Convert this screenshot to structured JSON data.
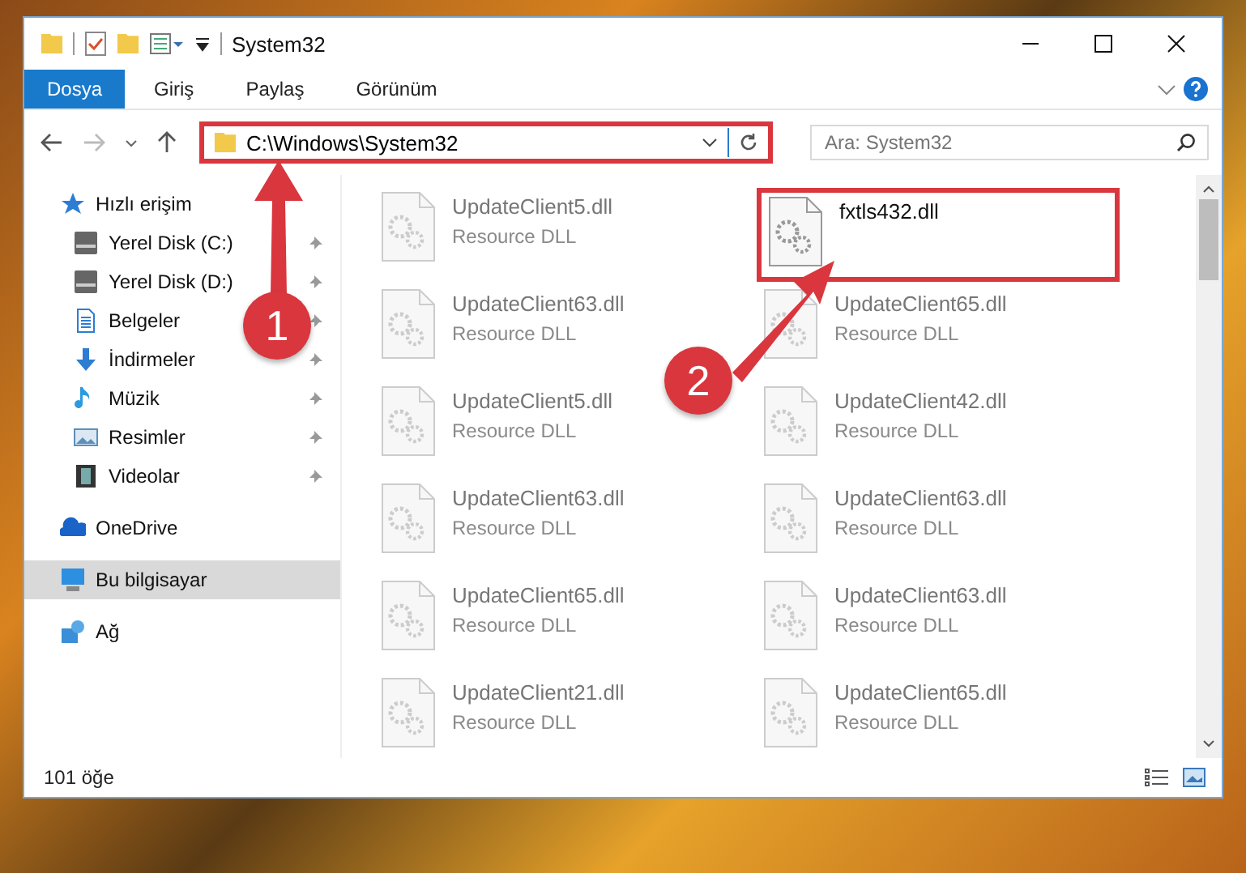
{
  "window": {
    "title": "System32"
  },
  "ribbon_tabs": [
    {
      "label": "Dosya",
      "selected": true
    },
    {
      "label": "Giriş",
      "selected": false
    },
    {
      "label": "Paylaş",
      "selected": false
    },
    {
      "label": "Görünüm",
      "selected": false
    }
  ],
  "address": {
    "value": "C:\\Windows\\System32",
    "highlighted": true
  },
  "search": {
    "placeholder": "Ara: System32"
  },
  "sidebar": {
    "items": [
      {
        "label": "Hızlı erişim",
        "kind": "star",
        "pinned": false,
        "selected": false,
        "children": [
          {
            "label": "Yerel Disk (C:)",
            "kind": "drive",
            "pinned": true,
            "selected": false
          },
          {
            "label": "Yerel Disk (D:)",
            "kind": "drive",
            "pinned": true,
            "selected": false
          },
          {
            "label": "Belgeler",
            "kind": "doc",
            "pinned": true,
            "selected": false
          },
          {
            "label": "İndirmeler",
            "kind": "download",
            "pinned": true,
            "selected": false
          },
          {
            "label": "Müzik",
            "kind": "music",
            "pinned": true,
            "selected": false
          },
          {
            "label": "Resimler",
            "kind": "picture",
            "pinned": true,
            "selected": false
          },
          {
            "label": "Videolar",
            "kind": "video",
            "pinned": true,
            "selected": false
          }
        ]
      },
      {
        "label": "OneDrive",
        "kind": "cloud",
        "pinned": false,
        "selected": false
      },
      {
        "label": "Bu bilgisayar",
        "kind": "computer",
        "pinned": false,
        "selected": true
      },
      {
        "label": "Ağ",
        "kind": "network",
        "pinned": false,
        "selected": false
      }
    ]
  },
  "files": [
    {
      "name": "UpdateClient5.dll",
      "type": "Resource DLL",
      "blurred": true,
      "highlighted": false
    },
    {
      "name": "fxtls432.dll",
      "blurred": false,
      "highlighted": true
    },
    {
      "name": "UpdateClient63.dll",
      "type": "Resource DLL",
      "blurred": true,
      "highlighted": false
    },
    {
      "name": "UpdateClient65.dll",
      "type": "Resource DLL",
      "blurred": true,
      "highlighted": false
    },
    {
      "name": "UpdateClient5.dll",
      "type": "Resource DLL",
      "blurred": true,
      "highlighted": false
    },
    {
      "name": "UpdateClient42.dll",
      "type": "Resource DLL",
      "blurred": true,
      "highlighted": false
    },
    {
      "name": "UpdateClient63.dll",
      "type": "Resource DLL",
      "blurred": true,
      "highlighted": false
    },
    {
      "name": "UpdateClient63.dll",
      "type": "Resource DLL",
      "blurred": true,
      "highlighted": false
    },
    {
      "name": "UpdateClient65.dll",
      "type": "Resource DLL",
      "blurred": true,
      "highlighted": false
    },
    {
      "name": "UpdateClient63.dll",
      "type": "Resource DLL",
      "blurred": true,
      "highlighted": false
    },
    {
      "name": "UpdateClient21.dll",
      "type": "Resource DLL",
      "blurred": true,
      "highlighted": false
    },
    {
      "name": "UpdateClient65.dll",
      "type": "Resource DLL",
      "blurred": true,
      "highlighted": false
    }
  ],
  "status_bar": {
    "count": "101 öğe"
  },
  "callouts": [
    "1",
    "2"
  ]
}
